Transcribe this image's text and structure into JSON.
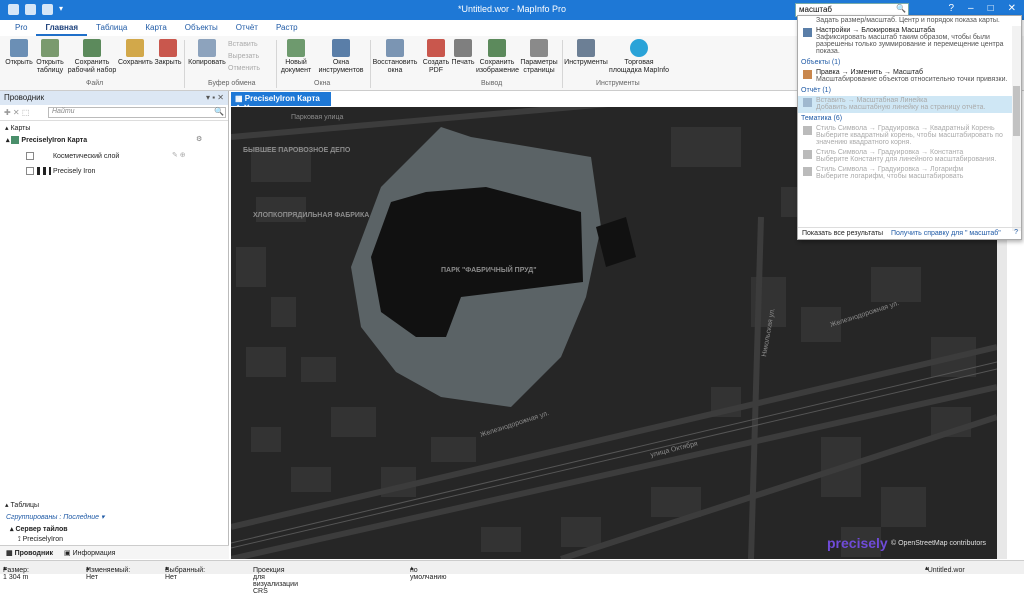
{
  "app": {
    "title": "*Untitled.wor - MapInfo Pro",
    "search_value": "масштаб"
  },
  "colors": {
    "titlebar": "#1e78d6",
    "map_bg": "#262626",
    "park": "#5b6366",
    "accent": "#1f5aa6"
  },
  "ribbon_tabs": [
    "Pro",
    "Главная",
    "Таблица",
    "Карта",
    "Объекты",
    "Отчёт",
    "Растр"
  ],
  "ribbon": {
    "open": "Открыть",
    "open_table": "Открыть таблицу",
    "save_workspace": "Сохранить рабочий набор",
    "save": "Сохранить",
    "close": "Закрыть",
    "group_file": "Файл",
    "copy": "Копировать",
    "paste": "Вставить",
    "cut": "Вырезать",
    "undo": "Отменить",
    "group_clipboard": "Буфер обмена",
    "new_document": "Новый документ",
    "tool_windows": "Окна инструментов",
    "group_windows": "Окна",
    "restore_windows": "Восстановить окна",
    "create_pdf": "Создать PDF",
    "print": "Печать",
    "save_image": "Сохранить изображение",
    "page_params": "Параметры страницы",
    "group_output": "Вывод",
    "tools": "Инструменты",
    "marketplace": "Торговая площадка MapInfo",
    "group_tools": "Инструменты"
  },
  "explorer": {
    "title": "Проводник",
    "find_placeholder": "Найти",
    "maps_label": "Карты",
    "map_name": "PreciselyIron Карта",
    "layers": [
      "Косметический слой",
      "Precisely Iron"
    ],
    "tables_label": "Таблицы",
    "grouped_label": "Сгруппированы : Последние",
    "tile_server_label": "Сервер тайлов",
    "tile_table": "PreciselyIron",
    "tab_explorer": "Проводник",
    "tab_info": "Информация"
  },
  "map_tab": {
    "title": "PreciselyIron Карта"
  },
  "map_labels": {
    "parkovaya": "Парковая улица",
    "depo": "БЫВШЕЕ ПАРОВОЗНОЕ ДЕПО",
    "fabrika": "ХЛОПКОПРЯДИЛЬНАЯ ФАБРИКА",
    "park": "ПАРК \"ФАБРИЧНЫЙ ПРУД\"",
    "nikolskaya": "Никольская ул.",
    "zheleznodorozhnaya": "Железнодорожная ул.",
    "oktyabrya": "улица Октября",
    "brand": "precisely",
    "copyright": "© OpenStreetMap contributors"
  },
  "status": {
    "scale": "Размер: 1 304 m",
    "changed": "Изменяемый: Нет",
    "selected": "Выбранный: Нет",
    "projection": "Проекция для визуализации CRS",
    "default": "по умолчанию",
    "workspace": "*Untitled.wor"
  },
  "dropdown": {
    "top_desc": "Задать размер/масштаб. Центр и порядок показа карты.",
    "item1_title": "Настройки → Блокировка Масштаба",
    "item1_desc": "Зафиксировать масштаб таким образом, чтобы были разрешены только зуммирование и перемещение центра показа.",
    "cat_objects": "Объекты (1)",
    "item2_title": "Правка → Изменить → Масштаб",
    "item2_desc": "Масштабирование объектов относительно точки привязки.",
    "cat_report": "Отчёт (1)",
    "item3_title": "Вставить → Масштабная Линейка",
    "item3_desc": "Добавить масштабную линейку на страницу отчёта.",
    "cat_thematic": "Тематика (6)",
    "item4_title": "Стиль Символа → Градуировка → Квадратный Корень",
    "item4_desc": "Выберите квадратный корень, чтобы масштабировать по значению квадратного корня.",
    "item5_title": "Стиль Символа → Градуировка → Константа",
    "item5_desc": "Выберите Константу для линейного масштабирования.",
    "item6_title": "Стиль Символа → Градуировка → Логарифм",
    "item6_desc": "Выберите логарифм, чтобы масштабировать",
    "show_all": "Показать все результаты",
    "help": "Получить справку для \" масштаб\""
  }
}
